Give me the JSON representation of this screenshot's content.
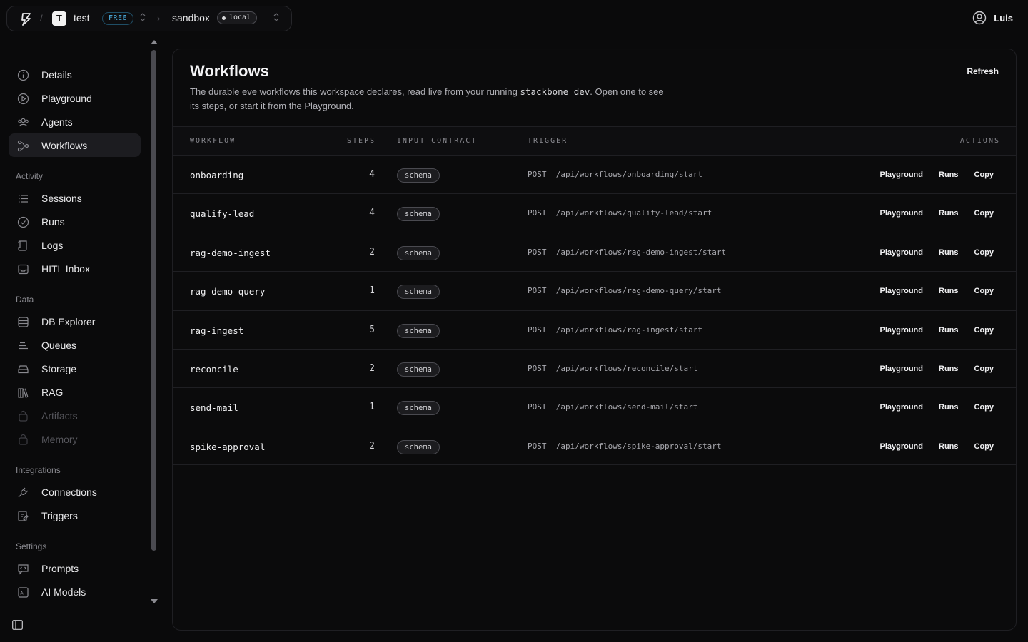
{
  "header": {
    "workspace": {
      "avatar": "T",
      "name": "test",
      "plan": "FREE"
    },
    "environment": {
      "name": "sandbox",
      "badge": "local"
    },
    "user": {
      "name": "Luis"
    },
    "separator": "/",
    "chevron": "›",
    "selector_glyph": "⌃⌄"
  },
  "sidebar": {
    "primary": [
      {
        "label": "Details",
        "icon": "info-icon"
      },
      {
        "label": "Playground",
        "icon": "play-icon"
      },
      {
        "label": "Agents",
        "icon": "users-icon"
      },
      {
        "label": "Workflows",
        "icon": "workflow-icon",
        "active": true
      }
    ],
    "sections": [
      {
        "label": "Activity",
        "items": [
          {
            "label": "Sessions",
            "icon": "list-icon"
          },
          {
            "label": "Runs",
            "icon": "check-circle-icon"
          },
          {
            "label": "Logs",
            "icon": "scroll-icon"
          },
          {
            "label": "HITL Inbox",
            "icon": "inbox-icon"
          }
        ]
      },
      {
        "label": "Data",
        "items": [
          {
            "label": "DB Explorer",
            "icon": "database-icon"
          },
          {
            "label": "Queues",
            "icon": "queue-icon"
          },
          {
            "label": "Storage",
            "icon": "storage-icon"
          },
          {
            "label": "RAG",
            "icon": "books-icon"
          },
          {
            "label": "Artifacts",
            "icon": "artifact-icon",
            "disabled": true
          },
          {
            "label": "Memory",
            "icon": "memory-icon",
            "disabled": true
          }
        ]
      },
      {
        "label": "Integrations",
        "items": [
          {
            "label": "Connections",
            "icon": "plug-icon"
          },
          {
            "label": "Triggers",
            "icon": "trigger-icon"
          }
        ]
      },
      {
        "label": "Settings",
        "items": [
          {
            "label": "Prompts",
            "icon": "prompt-icon"
          },
          {
            "label": "AI Models",
            "icon": "ai-icon"
          }
        ]
      }
    ]
  },
  "main": {
    "title": "Workflows",
    "description_before": "The durable eve workflows this workspace declares, read live from your running ",
    "description_code": "stackbone dev",
    "description_after": ". Open one to see its steps, or start it from the Playground.",
    "refresh_label": "Refresh",
    "columns": {
      "workflow": "WORKFLOW",
      "steps": "STEPS",
      "input_contract": "INPUT CONTRACT",
      "trigger": "TRIGGER",
      "actions": "ACTIONS"
    },
    "rows": [
      {
        "name": "onboarding",
        "steps": "4",
        "contract": "schema",
        "trigger": "POST  /api/workflows/onboarding/start"
      },
      {
        "name": "qualify-lead",
        "steps": "4",
        "contract": "schema",
        "trigger": "POST  /api/workflows/qualify-lead/start"
      },
      {
        "name": "rag-demo-ingest",
        "steps": "2",
        "contract": "schema",
        "trigger": "POST  /api/workflows/rag-demo-ingest/start"
      },
      {
        "name": "rag-demo-query",
        "steps": "1",
        "contract": "schema",
        "trigger": "POST  /api/workflows/rag-demo-query/start"
      },
      {
        "name": "rag-ingest",
        "steps": "5",
        "contract": "schema",
        "trigger": "POST  /api/workflows/rag-ingest/start"
      },
      {
        "name": "reconcile",
        "steps": "2",
        "contract": "schema",
        "trigger": "POST  /api/workflows/reconcile/start"
      },
      {
        "name": "send-mail",
        "steps": "1",
        "contract": "schema",
        "trigger": "POST  /api/workflows/send-mail/start"
      },
      {
        "name": "spike-approval",
        "steps": "2",
        "contract": "schema",
        "trigger": "POST  /api/workflows/spike-approval/start"
      }
    ],
    "row_actions": {
      "playground": "Playground",
      "runs": "Runs",
      "copy": "Copy"
    }
  }
}
